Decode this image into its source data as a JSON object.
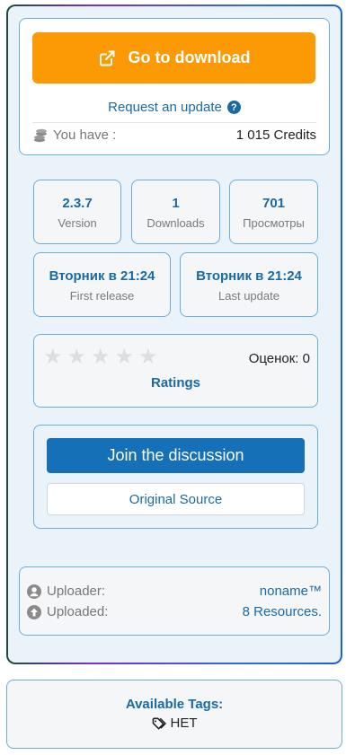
{
  "download": {
    "button_label": "Go to download",
    "request_update": "Request an update",
    "credits_label": "You have :",
    "credits_value": "1 015 Credits"
  },
  "stats": {
    "version": {
      "value": "2.3.7",
      "label": "Version"
    },
    "downloads": {
      "value": "1",
      "label": "Downloads"
    },
    "views": {
      "value": "701",
      "label": "Просмотры"
    },
    "first_release": {
      "value": "Вторник в 21:24",
      "label": "First release"
    },
    "last_update": {
      "value": "Вторник в 21:24",
      "label": "Last update"
    }
  },
  "rating": {
    "stars_filled": 0,
    "stars_total": 5,
    "count_text": "Оценок: 0",
    "label": "Ratings"
  },
  "discussion": {
    "join_label": "Join the discussion",
    "source_label": "Original Source"
  },
  "uploader": {
    "uploader_label": "Uploader:",
    "uploader_value": "noname™",
    "uploaded_label": "Uploaded:",
    "uploaded_value": "8 Resources."
  },
  "tags": {
    "title": "Available Tags:",
    "items": [
      "НЕТ"
    ]
  },
  "colors": {
    "download_button": "#fc9a05",
    "discuss_button": "#1670b8",
    "link": "#1a6aa6",
    "card_border": "#6aaede"
  }
}
